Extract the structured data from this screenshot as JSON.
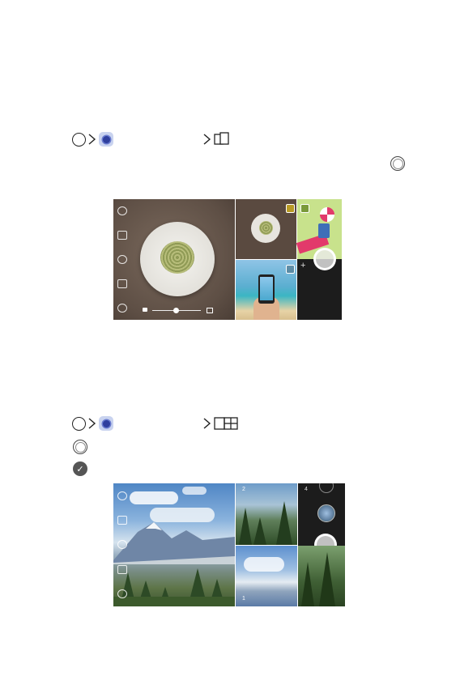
{
  "section1": {
    "path_icons": [
      "home-circle-icon",
      "camera-app-icon",
      "square-snap-mode-icon"
    ],
    "shutter_icon": "shutter-icon",
    "screenshot": {
      "description_icons": [
        "flash-icon",
        "mode-icon",
        "filter-icon",
        "ratio-icon",
        "settings-icon"
      ],
      "plus_label": "+"
    }
  },
  "section2": {
    "path_icons": [
      "home-circle-icon",
      "camera-app-icon",
      "grid-shot-mode-icon"
    ],
    "step_icons": [
      "shutter-icon",
      "check-icon"
    ],
    "check_glyph": "✓",
    "screenshot": {
      "cell_numbers": [
        "2",
        "4",
        "1"
      ]
    }
  },
  "colors": {
    "food_bg": "#6b5a4e",
    "plate": "#e9e7e2",
    "green_bg": "#c7e28a",
    "dark_panel": "#1c1c1c",
    "sky": "#7fa8d8"
  }
}
